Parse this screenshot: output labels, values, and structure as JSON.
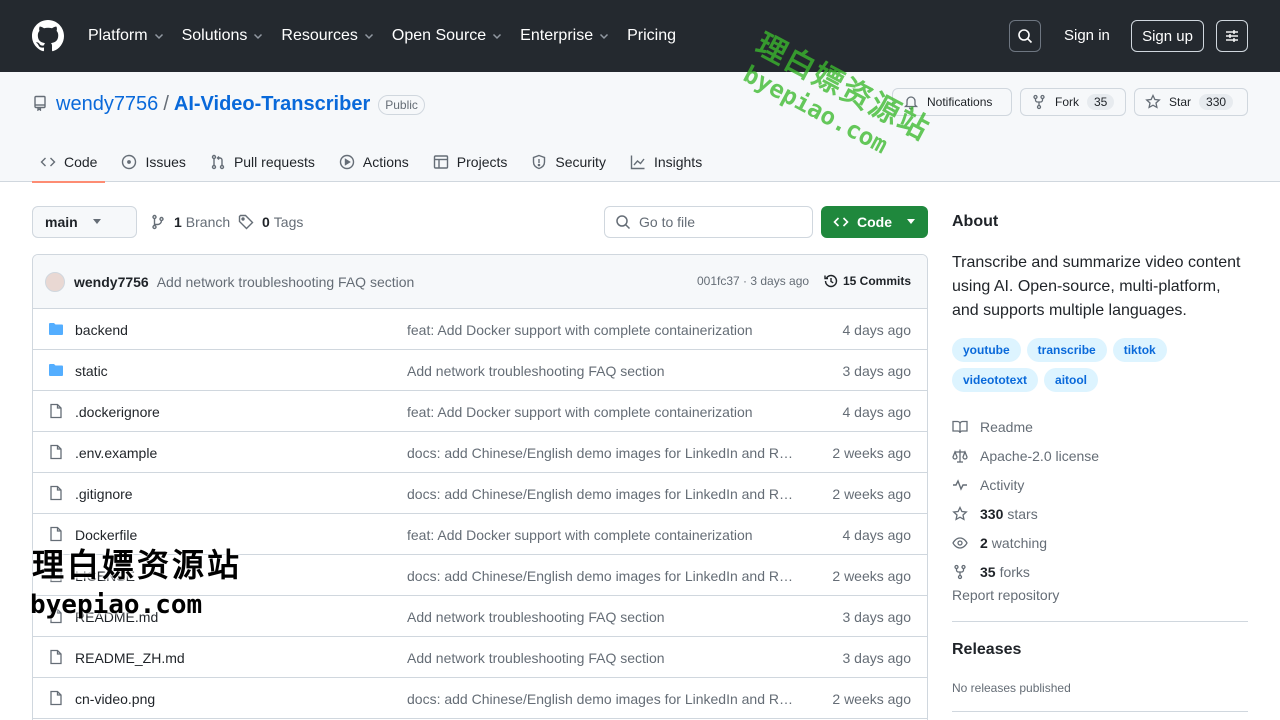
{
  "nav": {
    "items": [
      "Platform",
      "Solutions",
      "Resources",
      "Open Source",
      "Enterprise",
      "Pricing"
    ],
    "has_dropdown": [
      true,
      true,
      true,
      true,
      true,
      false
    ],
    "sign_in": "Sign in",
    "sign_up": "Sign up"
  },
  "repo": {
    "owner": "wendy7756",
    "separator": "/",
    "name": "AI-Video-Transcriber",
    "visibility": "Public",
    "notifications_label": "Notifications",
    "fork_label": "Fork",
    "fork_count": "35",
    "star_label": "Star",
    "star_count": "330"
  },
  "tabs": [
    "Code",
    "Issues",
    "Pull requests",
    "Actions",
    "Projects",
    "Security",
    "Insights"
  ],
  "toolbar": {
    "branch": "main",
    "branches_count": "1",
    "branches_label": "Branch",
    "tags_count": "0",
    "tags_label": "Tags",
    "goto_placeholder": "Go to file",
    "code_button": "Code"
  },
  "latest_commit": {
    "author": "wendy7756",
    "message": "Add network troubleshooting FAQ section",
    "hash_time": "001fc37 · 3 days ago",
    "commits_label": "15 Commits"
  },
  "files": [
    {
      "name": "backend",
      "type": "dir",
      "message": "feat: Add Docker support with complete containerization",
      "date": "4 days ago"
    },
    {
      "name": "static",
      "type": "dir",
      "message": "Add network troubleshooting FAQ section",
      "date": "3 days ago"
    },
    {
      "name": ".dockerignore",
      "type": "file",
      "message": "feat: Add Docker support with complete containerization",
      "date": "4 days ago"
    },
    {
      "name": ".env.example",
      "type": "file",
      "message": "docs: add Chinese/English demo images for LinkedIn and RE...",
      "date": "2 weeks ago"
    },
    {
      "name": ".gitignore",
      "type": "file",
      "message": "docs: add Chinese/English demo images for LinkedIn and RE...",
      "date": "2 weeks ago"
    },
    {
      "name": "Dockerfile",
      "type": "file",
      "message": "feat: Add Docker support with complete containerization",
      "date": "4 days ago"
    },
    {
      "name": "LICENSE",
      "type": "file",
      "message": "docs: add Chinese/English demo images for LinkedIn and RE...",
      "date": "2 weeks ago"
    },
    {
      "name": "README.md",
      "type": "file",
      "message": "Add network troubleshooting FAQ section",
      "date": "3 days ago"
    },
    {
      "name": "README_ZH.md",
      "type": "file",
      "message": "Add network troubleshooting FAQ section",
      "date": "3 days ago"
    },
    {
      "name": "cn-video.png",
      "type": "file",
      "message": "docs: add Chinese/English demo images for LinkedIn and RE...",
      "date": "2 weeks ago"
    }
  ],
  "about": {
    "heading": "About",
    "description": "Transcribe and summarize video content using AI. Open-source, multi-platform, and supports multiple languages.",
    "topics": [
      "youtube",
      "transcribe",
      "tiktok",
      "videototext",
      "aitool"
    ],
    "readme": "Readme",
    "license": "Apache-2.0 license",
    "activity": "Activity",
    "stars_count": "330",
    "stars_label": "stars",
    "watching_count": "2",
    "watching_label": "watching",
    "forks_count": "35",
    "forks_label": "forks",
    "report": "Report repository"
  },
  "releases": {
    "heading": "Releases",
    "empty": "No releases published"
  },
  "watermark": {
    "cn": "理白嫖资源站",
    "url": "byepiao.com"
  },
  "colors": {
    "header_bg": "#24292f",
    "link": "#0969da",
    "primary_button": "#1f883d",
    "active_tab_underline": "#fd8c73",
    "watermark_green": "#3cba2e"
  }
}
